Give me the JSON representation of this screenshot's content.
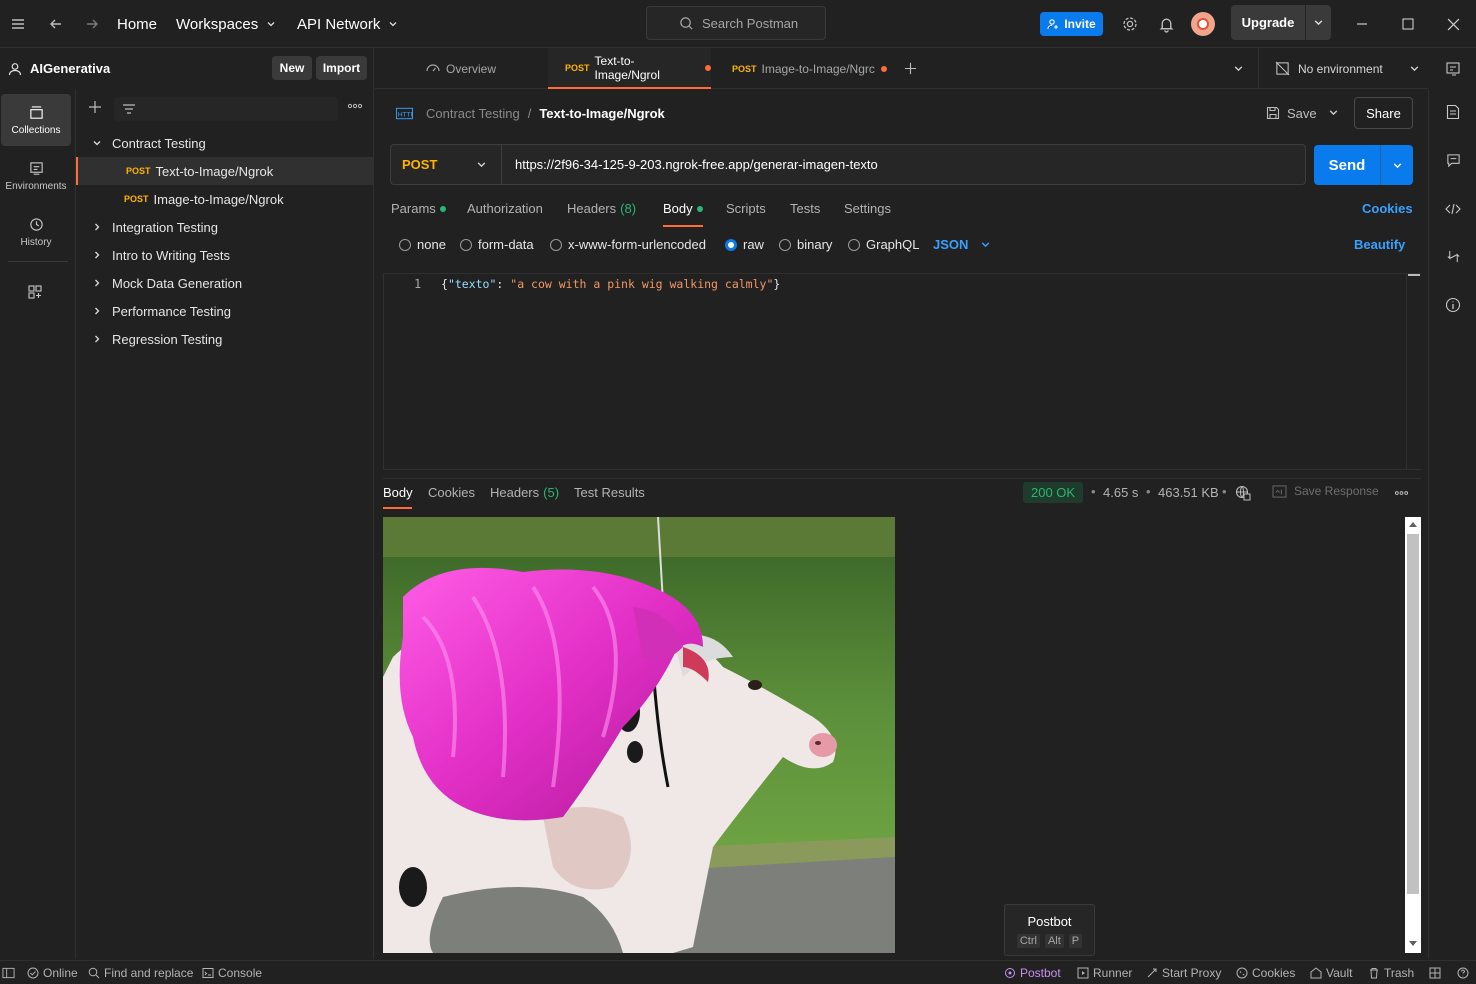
{
  "titlebar": {
    "home": "Home",
    "workspaces": "Workspaces",
    "api_network": "API Network",
    "search_placeholder": "Search Postman",
    "invite": "Invite",
    "upgrade": "Upgrade"
  },
  "workspace": {
    "name": "AIGenerativa",
    "new_label": "New",
    "import_label": "Import"
  },
  "rail": [
    {
      "label": "Collections",
      "icon": "collections-icon"
    },
    {
      "label": "Environments",
      "icon": "environments-icon"
    },
    {
      "label": "History",
      "icon": "history-icon"
    }
  ],
  "collections": {
    "open": {
      "name": "Contract Testing",
      "requests": [
        {
          "method": "POST",
          "name": "Text-to-Image/Ngrok"
        },
        {
          "method": "POST",
          "name": "Image-to-Image/Ngrok"
        }
      ]
    },
    "closed": [
      "Integration Testing",
      "Intro to Writing Tests",
      "Mock Data Generation",
      "Performance Testing",
      "Regression Testing"
    ]
  },
  "tabs": {
    "overview": "Overview",
    "tab1_method": "POST",
    "tab1_name": "Text-to-Image/Ngrol",
    "tab2_method": "POST",
    "tab2_name": "Image-to-Image/Ngrc",
    "environment": "No environment"
  },
  "breadcrumb": {
    "parent": "Contract Testing",
    "separator": "/",
    "current": "Text-to-Image/Ngrok",
    "save": "Save",
    "share": "Share"
  },
  "request": {
    "method": "POST",
    "url": "https://2f96-34-125-9-203.ngrok-free.app/generar-imagen-texto",
    "send": "Send"
  },
  "request_tabs": {
    "params": "Params",
    "authorization": "Authorization",
    "headers": "Headers",
    "headers_count": "(8)",
    "body": "Body",
    "scripts": "Scripts",
    "tests": "Tests",
    "settings": "Settings",
    "cookies": "Cookies"
  },
  "body_types": {
    "none": "none",
    "form_data": "form-data",
    "urlencoded": "x-www-form-urlencoded",
    "raw": "raw",
    "binary": "binary",
    "graphql": "GraphQL",
    "format": "JSON",
    "beautify": "Beautify"
  },
  "editor": {
    "line_number": "1",
    "brace_open": "{",
    "key": "\"texto\"",
    "colon": ": ",
    "value": "\"a cow with a pink wig walking calmly\"",
    "brace_close": "}"
  },
  "response": {
    "tabs": {
      "body": "Body",
      "cookies": "Cookies",
      "headers": "Headers",
      "headers_count": "(5)",
      "test_results": "Test Results"
    },
    "status": "200 OK",
    "time": "4.65 s",
    "size": "463.51 KB",
    "save_response": "Save Response"
  },
  "postbot_popup": {
    "title": "Postbot",
    "keys": [
      "Ctrl",
      "Alt",
      "P"
    ]
  },
  "statusbar": {
    "online": "Online",
    "find_replace": "Find and replace",
    "console": "Console",
    "postbot": "Postbot",
    "runner": "Runner",
    "start_proxy": "Start Proxy",
    "cookies": "Cookies",
    "vault": "Vault",
    "trash": "Trash"
  },
  "colors": {
    "accent_blue": "#097bed",
    "method_post": "#ffb400",
    "brand_orange": "#ff6c37",
    "status_ok": "#2bb673"
  }
}
